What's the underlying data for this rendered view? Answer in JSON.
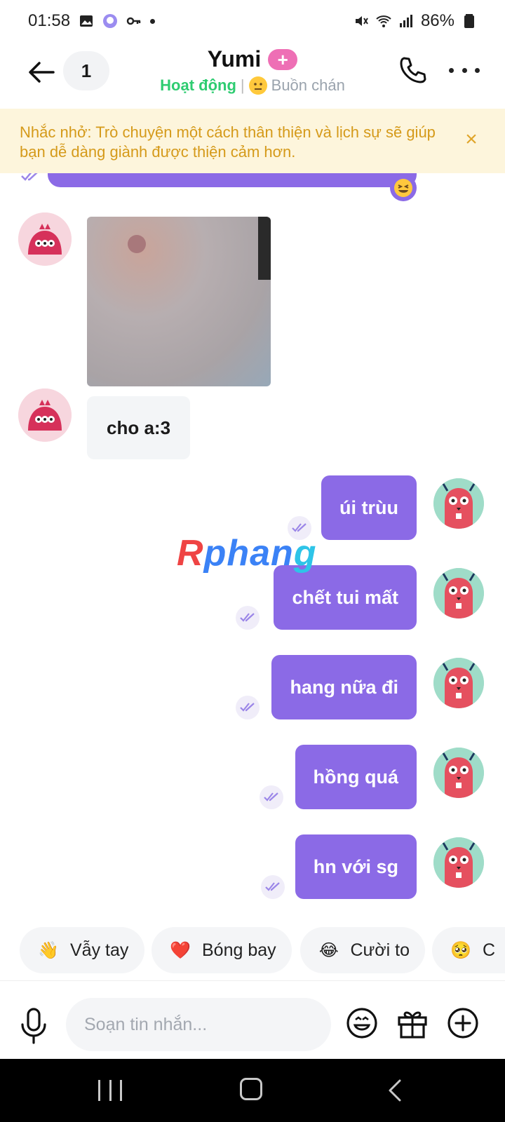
{
  "status_bar": {
    "time": "01:58",
    "battery": "86%"
  },
  "header": {
    "back_count": "1",
    "title": "Yumi",
    "plus_badge": "+",
    "status_active": "Hoạt động",
    "separator": "|",
    "mood": "Buồn chán"
  },
  "reminder": {
    "text": "Nhắc nhở: Trò chuyện một cách thân thiện và lịch sự sẽ giúp bạn dễ dàng giành được thiện cảm hơn.",
    "close": "×"
  },
  "messages": {
    "incoming_text": "cho a:3",
    "outgoing": [
      "úi trùu",
      "chết tui mất",
      "hang nữa đi",
      "hồng quá",
      "hn với sg"
    ]
  },
  "watermark": {
    "r": "R",
    "phan": "phan",
    "g": "g"
  },
  "quick_replies": [
    {
      "emoji": "👋",
      "label": "Vẫy tay"
    },
    {
      "emoji": "❤️",
      "label": "Bóng bay"
    },
    {
      "emoji": "😂",
      "label": "Cười to"
    },
    {
      "emoji": "🥺",
      "label": "C"
    }
  ],
  "composer": {
    "placeholder": "Soạn tin nhắn..."
  },
  "colors": {
    "accent": "#8b6ae6",
    "active_green": "#2ecc71",
    "reminder_bg": "#fdf5dc",
    "reminder_text": "#d59a1a"
  },
  "icons": [
    "back-arrow-icon",
    "phone-icon",
    "more-icon",
    "close-icon",
    "mic-icon",
    "emoji-icon",
    "gift-icon",
    "plus-icon"
  ]
}
